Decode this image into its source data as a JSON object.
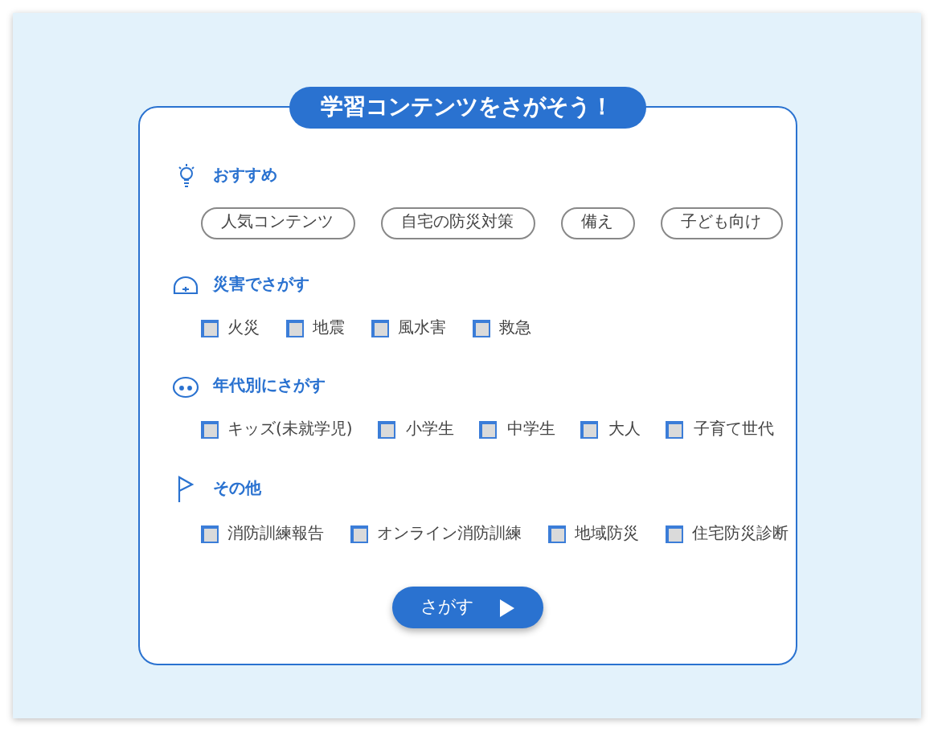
{
  "title": "学習コンテンツをさがそう！",
  "sections": [
    {
      "kind": "tags",
      "heading": "おすすめ",
      "items": [
        {
          "label": "人気コンテンツ"
        },
        {
          "label": "自宅の防災対策"
        },
        {
          "label": "備え"
        },
        {
          "label": "子ども向け"
        }
      ]
    },
    {
      "kind": "checkboxes",
      "heading": "災害でさがす",
      "items": [
        {
          "label": "火災",
          "checked": false
        },
        {
          "label": "地震",
          "checked": false
        },
        {
          "label": "風水害",
          "checked": false
        },
        {
          "label": "救急",
          "checked": false
        }
      ]
    },
    {
      "kind": "checkboxes",
      "heading": "年代別にさがす",
      "items": [
        {
          "label": "キッズ(未就学児)",
          "checked": false
        },
        {
          "label": "小学生",
          "checked": false
        },
        {
          "label": "中学生",
          "checked": false
        },
        {
          "label": "大人",
          "checked": false
        },
        {
          "label": "子育て世代",
          "checked": false
        }
      ]
    },
    {
      "kind": "checkboxes",
      "heading": "その他",
      "items": [
        {
          "label": "消防訓練報告",
          "checked": false
        },
        {
          "label": "オンライン消防訓練",
          "checked": false
        },
        {
          "label": "地域防災",
          "checked": false
        },
        {
          "label": "住宅防災診断",
          "checked": false
        }
      ]
    }
  ],
  "search_button": {
    "label": "さがす"
  }
}
